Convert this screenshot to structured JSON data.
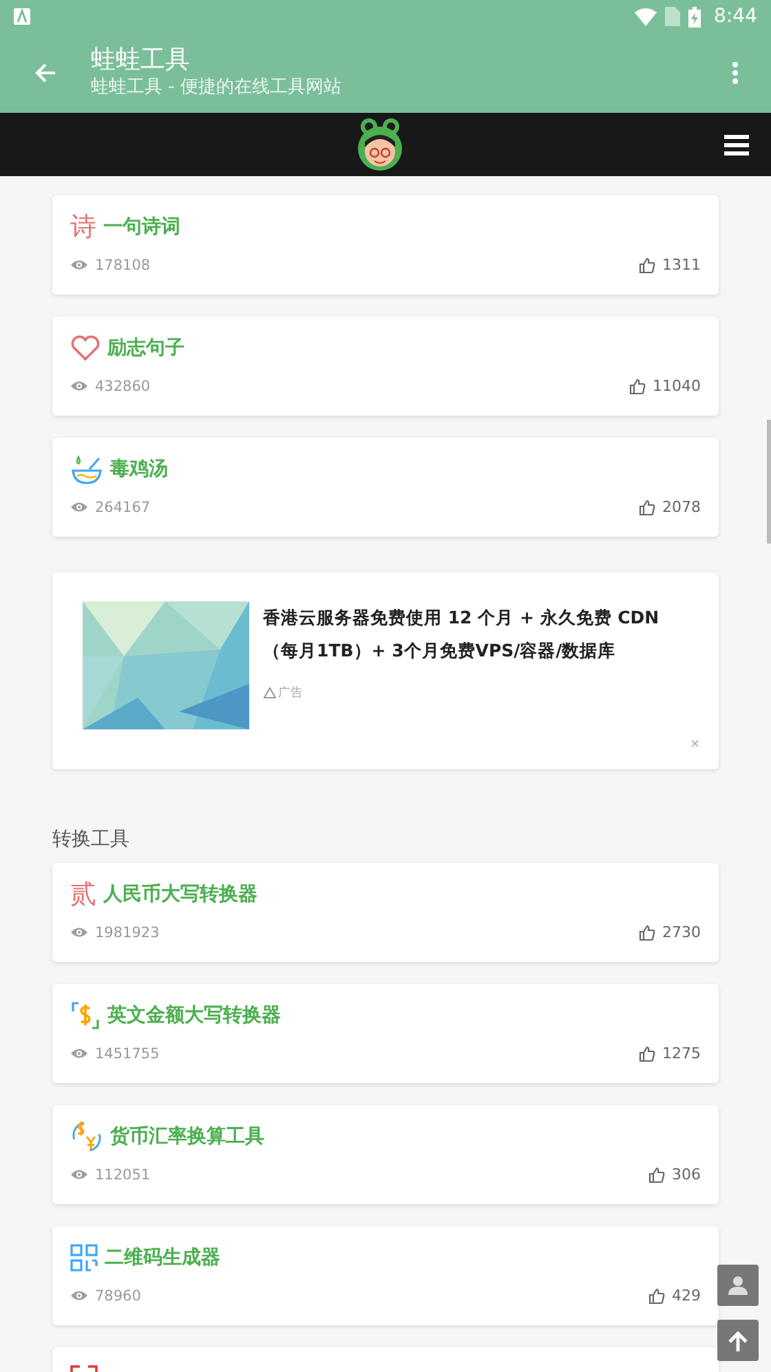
{
  "status_bar": {
    "time": "8:44"
  },
  "app_bar": {
    "title": "蛙蛙工具",
    "subtitle": "蛙蛙工具 - 便捷的在线工具网站"
  },
  "sections": [
    {
      "items": [
        {
          "kind": "char",
          "icon_text": "诗",
          "color": "#e57373",
          "title": "一句诗词",
          "views": "178108",
          "likes": "1311"
        },
        {
          "kind": "heart",
          "title": "励志句子",
          "views": "432860",
          "likes": "11040"
        },
        {
          "kind": "bowl",
          "title": "毒鸡汤",
          "views": "264167",
          "likes": "2078"
        }
      ],
      "ad": {
        "text": "香港云服务器免费使用 12 个月 + 永久免费 CDN （每月1TB）+ 3个月免费VPS/容器/数据库",
        "label": "广告",
        "close": "×"
      }
    },
    {
      "heading": "转换工具",
      "items": [
        {
          "kind": "char",
          "icon_text": "贰",
          "color": "#e57373",
          "title": "人民币大写转换器",
          "views": "1981923",
          "likes": "2730"
        },
        {
          "kind": "dollar",
          "title": "英文金额大写转换器",
          "views": "1451755",
          "likes": "1275"
        },
        {
          "kind": "exchange",
          "title": "货币汇率换算工具",
          "views": "112051",
          "likes": "306"
        },
        {
          "kind": "qr",
          "title": "二维码生成器",
          "views": "78960",
          "likes": "429"
        },
        {
          "kind": "scan"
        }
      ]
    }
  ]
}
